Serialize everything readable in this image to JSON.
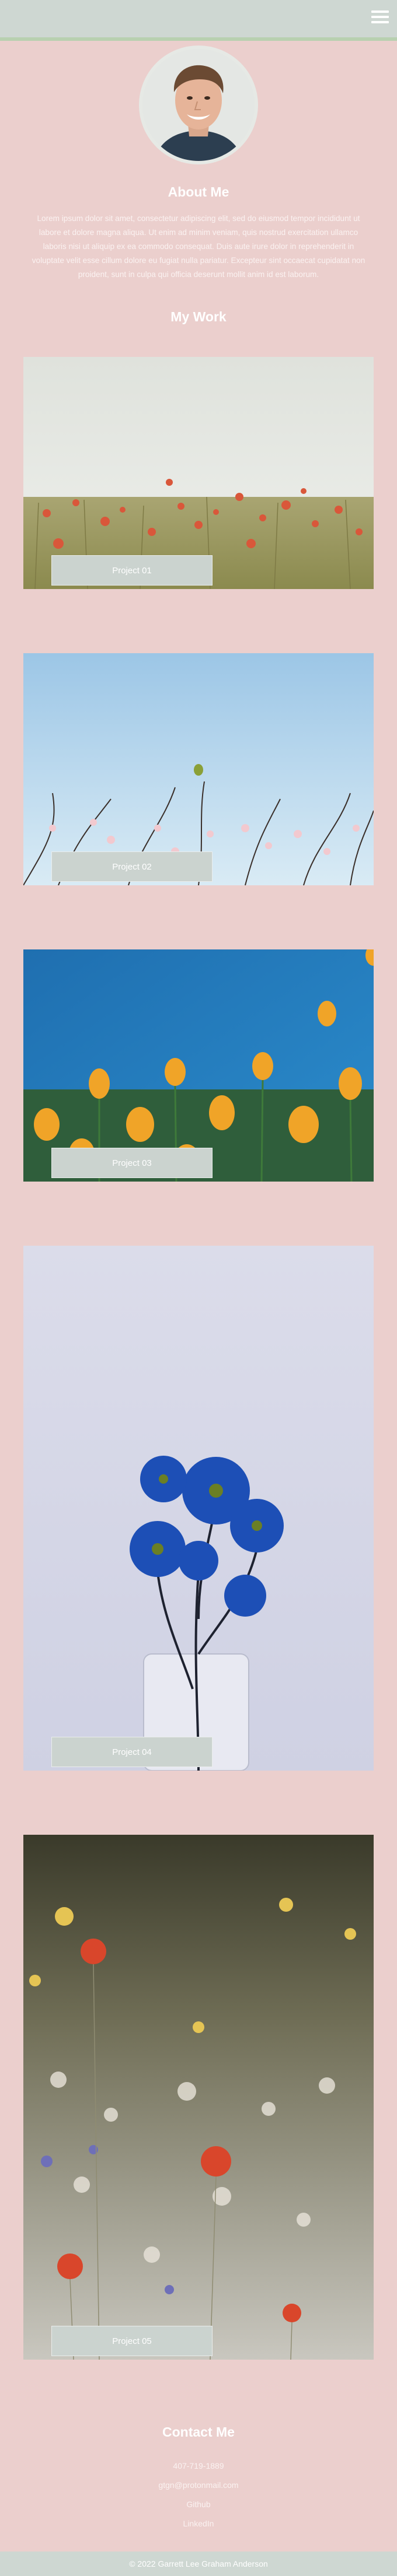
{
  "header": {
    "menu_icon": "hamburger-menu-icon"
  },
  "about": {
    "title": "About Me",
    "text": "Lorem ipsum dolor sit amet, consectetur adipiscing elit, sed do eiusmod tempor incididunt ut labore et dolore magna aliqua. Ut enim ad minim veniam, quis nostrud exercitation ullamco laboris nisi ut aliquip ex ea commodo consequat. Duis aute irure dolor in reprehenderit in voluptate velit esse cillum dolore eu fugiat nulla pariatur. Excepteur sint occaecat cupidatat non proident, sunt in culpa qui officia deserunt mollit anim id est laborum."
  },
  "work": {
    "title": "My Work",
    "projects": [
      {
        "label": "Project 01",
        "image": "poppy-meadow-photo"
      },
      {
        "label": "Project 02",
        "image": "blossom-branches-photo"
      },
      {
        "label": "Project 03",
        "image": "yellow-tulips-photo"
      },
      {
        "label": "Project 04",
        "image": "blue-daisies-vase-photo"
      },
      {
        "label": "Project 05",
        "image": "wildflower-field-photo"
      }
    ]
  },
  "contact": {
    "title": "Contact Me",
    "phone": "407-719-1889",
    "email": "gtgn@protonmail.com",
    "github": "Github",
    "linkedin": "LinkedIn"
  },
  "footer": {
    "text": "© 2022 Garrett Lee Graham Anderson"
  },
  "colors": {
    "background": "#ebcfcd",
    "header": "#ced7d2",
    "header_accent": "#b8d0b0",
    "label_bg": "#cbd3cf",
    "text": "#ffffff"
  }
}
